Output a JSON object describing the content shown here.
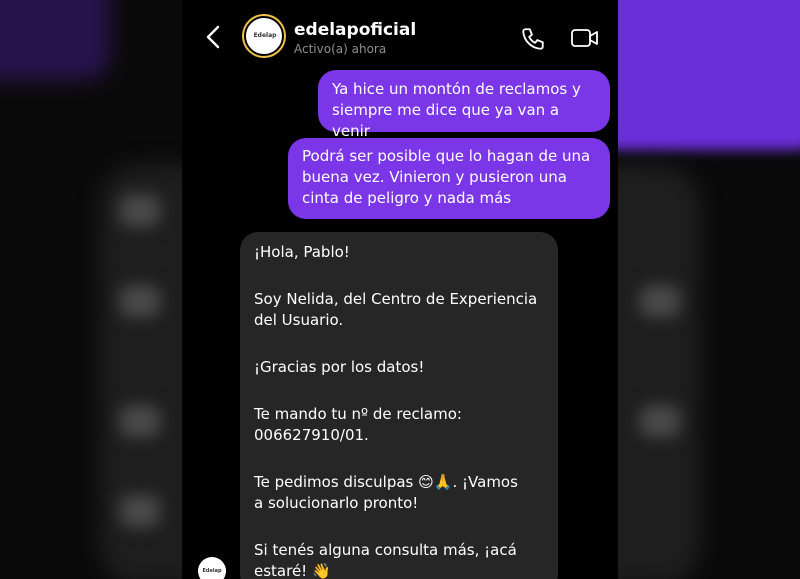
{
  "header": {
    "contact_name": "edelapoficial",
    "status": "Activo(a) ahora",
    "avatar_logo_text": "Edelap"
  },
  "messages_sent": [
    {
      "text": "Ya hice un montón de reclamos y\nsiempre me dice que ya van a venir"
    },
    {
      "text": "Podrá ser posible que lo hagan de una\nbuena vez. Vinieron y pusieron una\ncinta de peligro y nada más"
    }
  ],
  "message_received": {
    "greeting": "¡Hola, Pablo!",
    "intro": "Soy Nelida, del Centro de Experiencia\ndel Usuario.",
    "thanks": "¡Gracias por los datos!",
    "claim_label": "Te mando tu nº de reclamo:",
    "claim_number": "006627910/01.",
    "apology_before": "Te pedimos disculpas ",
    "apology_emojis": "😊🙏",
    "apology_after": ". ¡Vamos\na solucionarlo pronto!",
    "closing_text": "Si tenés alguna consulta más, ¡acá\nestaré! ",
    "closing_emoji": "👋"
  },
  "colors": {
    "sent_bubble": "#7b36e8",
    "received_bubble": "#262626",
    "background": "#000000",
    "status_text": "#8e8e8e",
    "avatar_ring": "#f3c24a"
  },
  "icons": [
    "chevron-left-icon",
    "phone-icon",
    "video-camera-icon"
  ]
}
